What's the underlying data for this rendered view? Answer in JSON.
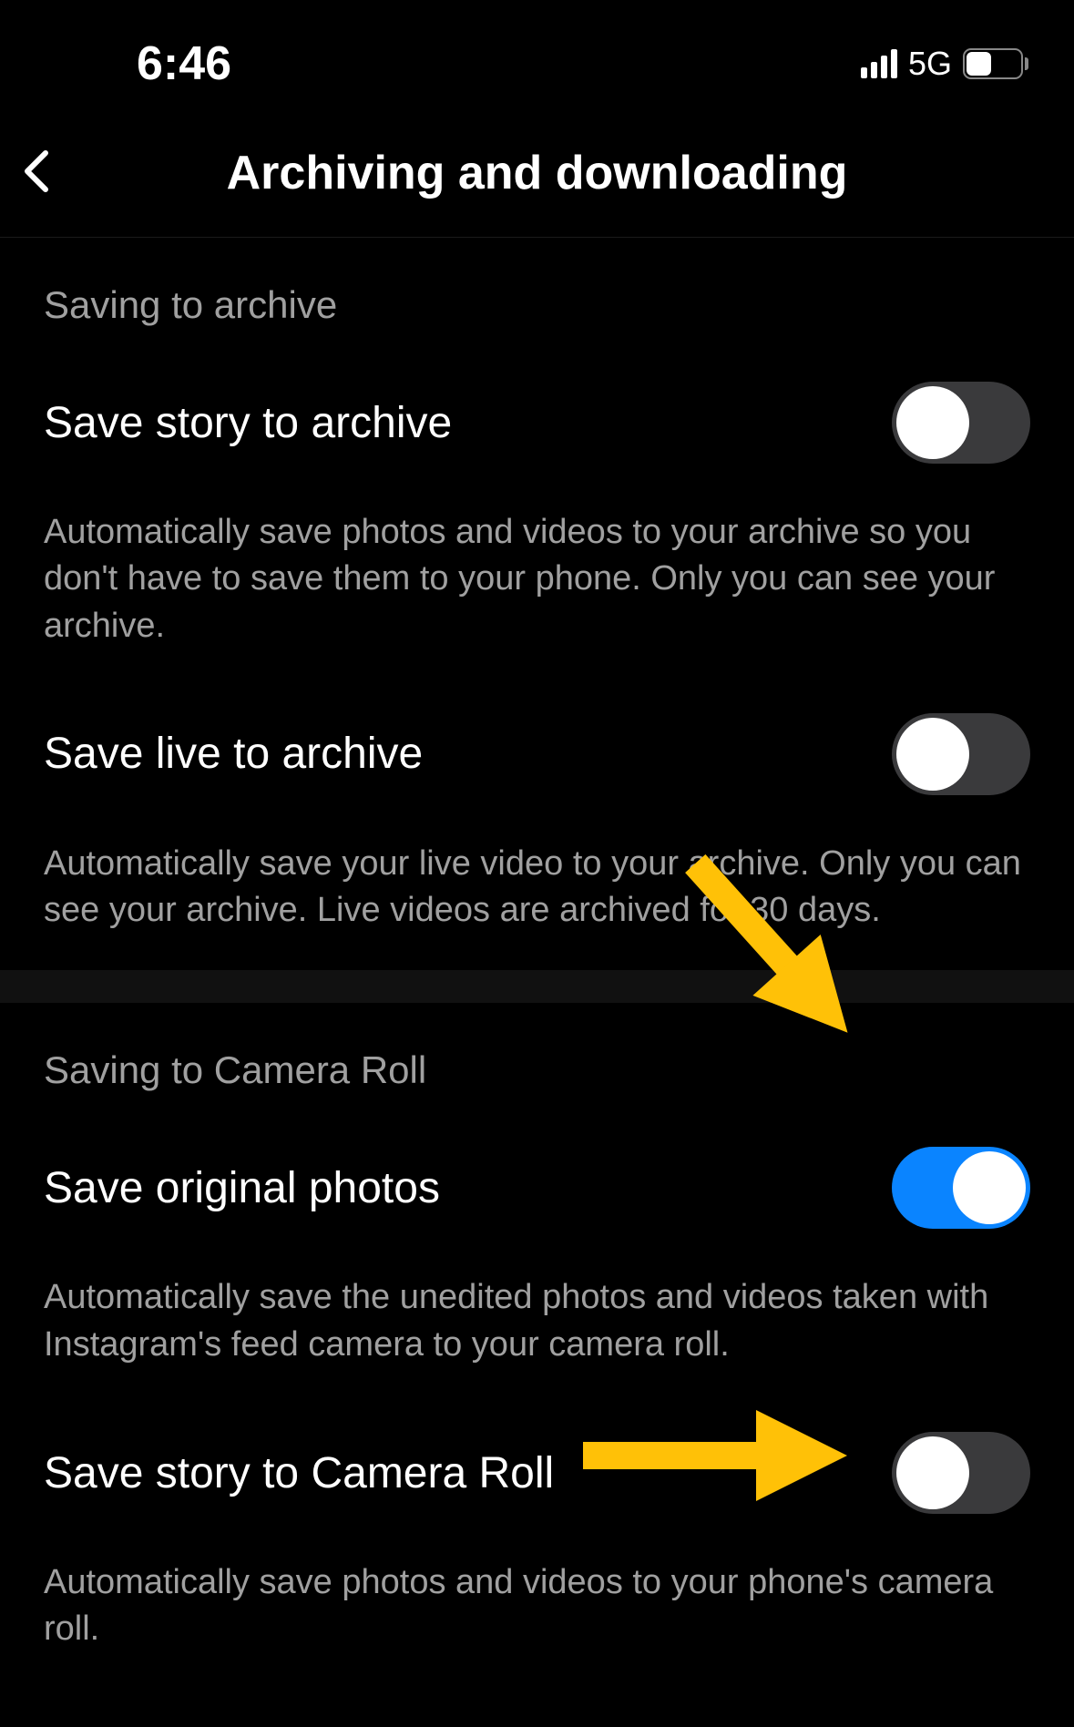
{
  "statusBar": {
    "time": "6:46",
    "networkType": "5G",
    "batteryLevel": "46"
  },
  "nav": {
    "title": "Archiving and downloading"
  },
  "sections": [
    {
      "header": "Saving to archive",
      "settings": [
        {
          "label": "Save story to archive",
          "description": "Automatically save photos and videos to your archive so you don't have to save them to your phone. Only you can see your archive.",
          "toggled": false
        },
        {
          "label": "Save live to archive",
          "description": "Automatically save your live video to your archive. Only you can see your archive. Live videos are archived for 30 days.",
          "toggled": false
        }
      ]
    },
    {
      "header": "Saving to Camera Roll",
      "settings": [
        {
          "label": "Save original photos",
          "description": "Automatically save the unedited photos and videos taken with Instagram's feed camera to your camera roll.",
          "toggled": true
        },
        {
          "label": "Save story to Camera Roll",
          "description": "Automatically save photos and videos to your phone's camera roll.",
          "toggled": false
        }
      ]
    }
  ]
}
